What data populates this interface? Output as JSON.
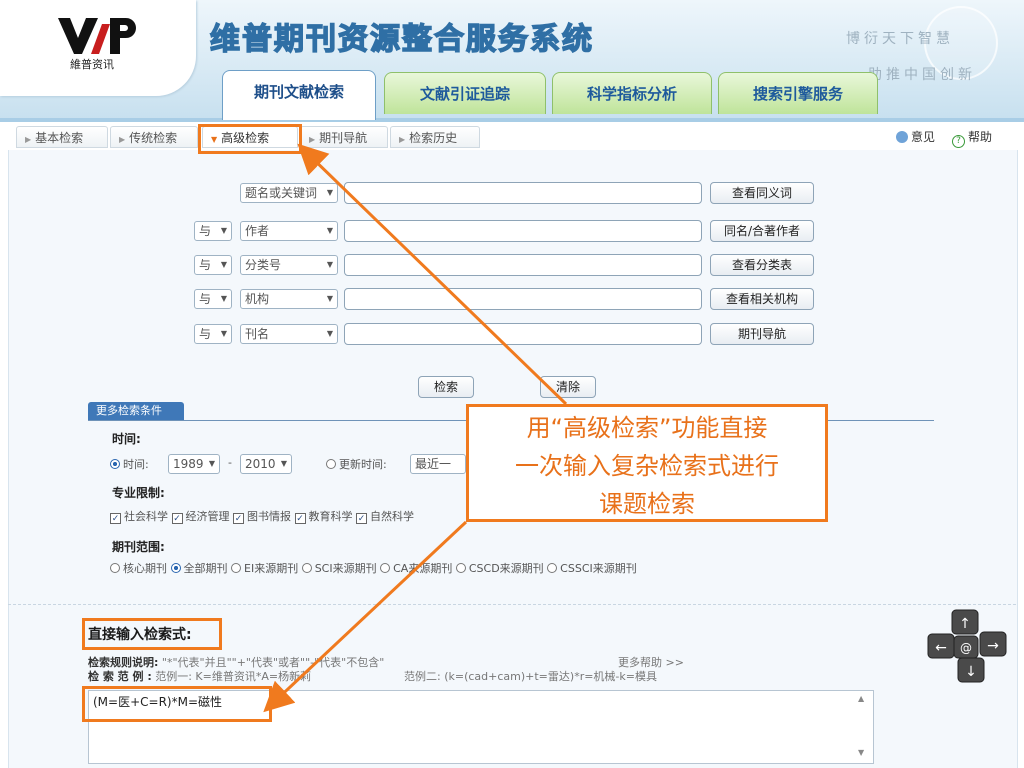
{
  "header": {
    "logo_text": "維普资讯",
    "system_title": "维普期刊资源整合服务系统",
    "slogan_line1": "博衍天下智慧",
    "slogan_line2": "助推中国创新"
  },
  "main_tabs": [
    {
      "label": "期刊文献检索",
      "active": true
    },
    {
      "label": "文献引证追踪",
      "active": false
    },
    {
      "label": "科学指标分析",
      "active": false
    },
    {
      "label": "搜索引擎服务",
      "active": false
    }
  ],
  "sub_tabs": [
    {
      "label": "基本检索"
    },
    {
      "label": "传统检索"
    },
    {
      "label": "高级检索",
      "active": true
    },
    {
      "label": "期刊导航"
    },
    {
      "label": "检索历史"
    }
  ],
  "top_links": {
    "feedback": "意见",
    "help": "帮助"
  },
  "search_rows": [
    {
      "logic": "",
      "field": "题名或关键词",
      "action": "查看同义词"
    },
    {
      "logic": "与",
      "field": "作者",
      "action": "同名/合著作者"
    },
    {
      "logic": "与",
      "field": "分类号",
      "action": "查看分类表"
    },
    {
      "logic": "与",
      "field": "机构",
      "action": "查看相关机构"
    },
    {
      "logic": "与",
      "field": "刊名",
      "action": "期刊导航"
    }
  ],
  "buttons": {
    "search": "检索",
    "clear": "清除"
  },
  "more_conditions": {
    "tab_label": "更多检索条件",
    "time_heading": "时间:",
    "time_label": "时间:",
    "year_from": "1989",
    "year_to": "2010",
    "dash": "-",
    "update_label": "更新时间:",
    "update_value": "最近一周",
    "subject_heading": "专业限制:",
    "subjects": [
      "社会科学",
      "经济管理",
      "图书情报",
      "教育科学",
      "自然科学"
    ],
    "scope_heading": "期刊范围:",
    "scopes": [
      {
        "label": "核心期刊",
        "selected": false
      },
      {
        "label": "全部期刊",
        "selected": true
      },
      {
        "label": "EI来源期刊",
        "selected": false
      },
      {
        "label": "SCI来源期刊",
        "selected": false
      },
      {
        "label": "CA来源期刊",
        "selected": false
      },
      {
        "label": "CSCD来源期刊",
        "selected": false
      },
      {
        "label": "CSSCI来源期刊",
        "selected": false
      }
    ]
  },
  "direct": {
    "title": "直接输入检索式:",
    "rule_label": "检索规则说明:",
    "rule_text": "\"*\"代表\"并且\"\"+\"代表\"或者\"\"-\"代表\"不包含\"",
    "more_help": "更多帮助 >>",
    "example_label": "检 索 范 例 :",
    "example1": "范例一: K=维普资讯*A=杨新莉",
    "example2": "范例二: (k=(cad+cam)+t=雷达)*r=机械-k=模具",
    "expression": "(M=医+C=R)*M=磁性"
  },
  "callout": {
    "line1": "用“高级检索”功能直接",
    "line2": "一次输入复杂检索式进行",
    "line3": "课题检索"
  },
  "colors": {
    "accent": "#f07a1e",
    "tab_green": "#bfe49a",
    "link_blue": "#1e5a9c"
  }
}
